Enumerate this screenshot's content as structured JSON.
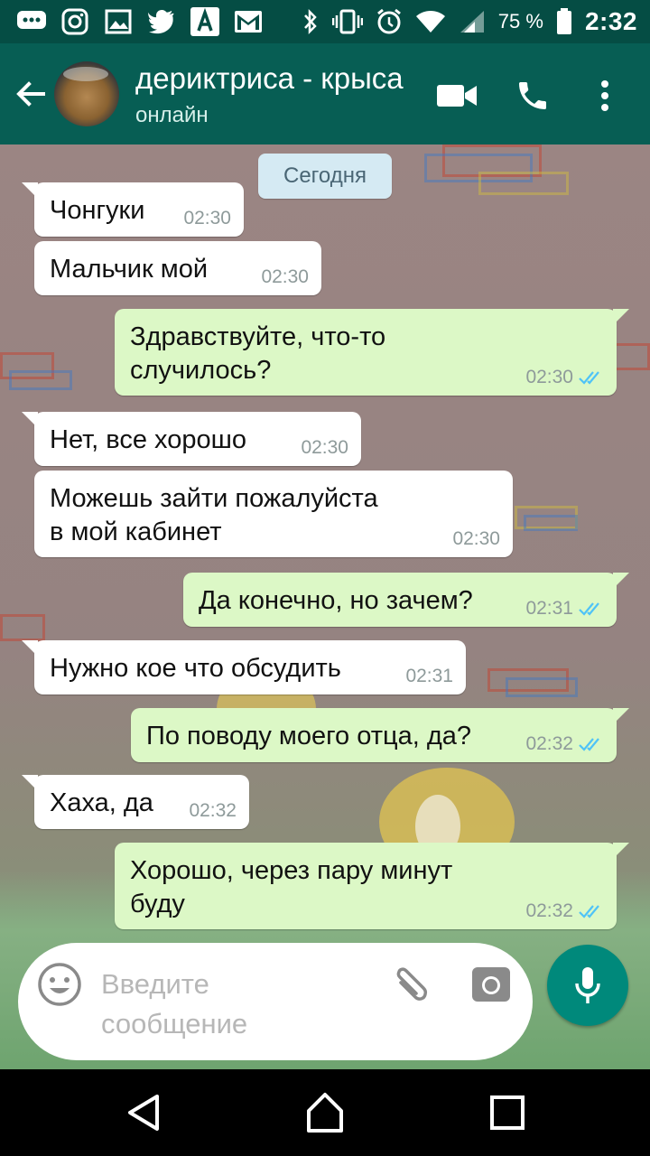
{
  "status_bar": {
    "icons": [
      "chat-bubble-icon",
      "instagram-icon",
      "image-icon",
      "twitter-icon",
      "a-app-icon",
      "gmail-icon",
      "bluetooth-icon",
      "vibrate-icon",
      "alarm-icon",
      "wifi-icon",
      "signal-icon",
      "battery-icon"
    ],
    "battery": "75 %",
    "time": "2:32"
  },
  "header": {
    "contact_name": "дериктриса - крыса",
    "status": "онлайн",
    "background": "#075e54"
  },
  "chat": {
    "date_label": "Сегодня",
    "messages": [
      {
        "dir": "in",
        "lines": [
          "Чонгуки"
        ],
        "time": "02:30"
      },
      {
        "dir": "in",
        "lines": [
          "Мальчик мой"
        ],
        "time": "02:30"
      },
      {
        "dir": "out",
        "lines": [
          "Здравствуйте, что-то",
          "случилось?"
        ],
        "time": "02:30",
        "read": true
      },
      {
        "dir": "in",
        "lines": [
          "Нет, все хорошо"
        ],
        "time": "02:30"
      },
      {
        "dir": "in",
        "lines": [
          "Можешь зайти пожалуйста",
          "в мой кабинет"
        ],
        "time": "02:30"
      },
      {
        "dir": "out",
        "lines": [
          "Да конечно, но зачем?"
        ],
        "time": "02:31",
        "read": true
      },
      {
        "dir": "in",
        "lines": [
          "Нужно кое что обсудить"
        ],
        "time": "02:31"
      },
      {
        "dir": "out",
        "lines": [
          "По поводу моего отца, да?"
        ],
        "time": "02:32",
        "read": true
      },
      {
        "dir": "in",
        "lines": [
          "Хаха, да"
        ],
        "time": "02:32"
      },
      {
        "dir": "out",
        "lines": [
          "Хорошо, через пару минут",
          "буду"
        ],
        "time": "02:32",
        "read": true
      }
    ],
    "incoming_color": "#ffffff",
    "outgoing_color": "#dcf8c6",
    "read_tick_color": "#4fc3f7"
  },
  "input": {
    "placeholder_line1": "Введите",
    "placeholder_line2": "сообщение",
    "accent": "#00897b"
  }
}
